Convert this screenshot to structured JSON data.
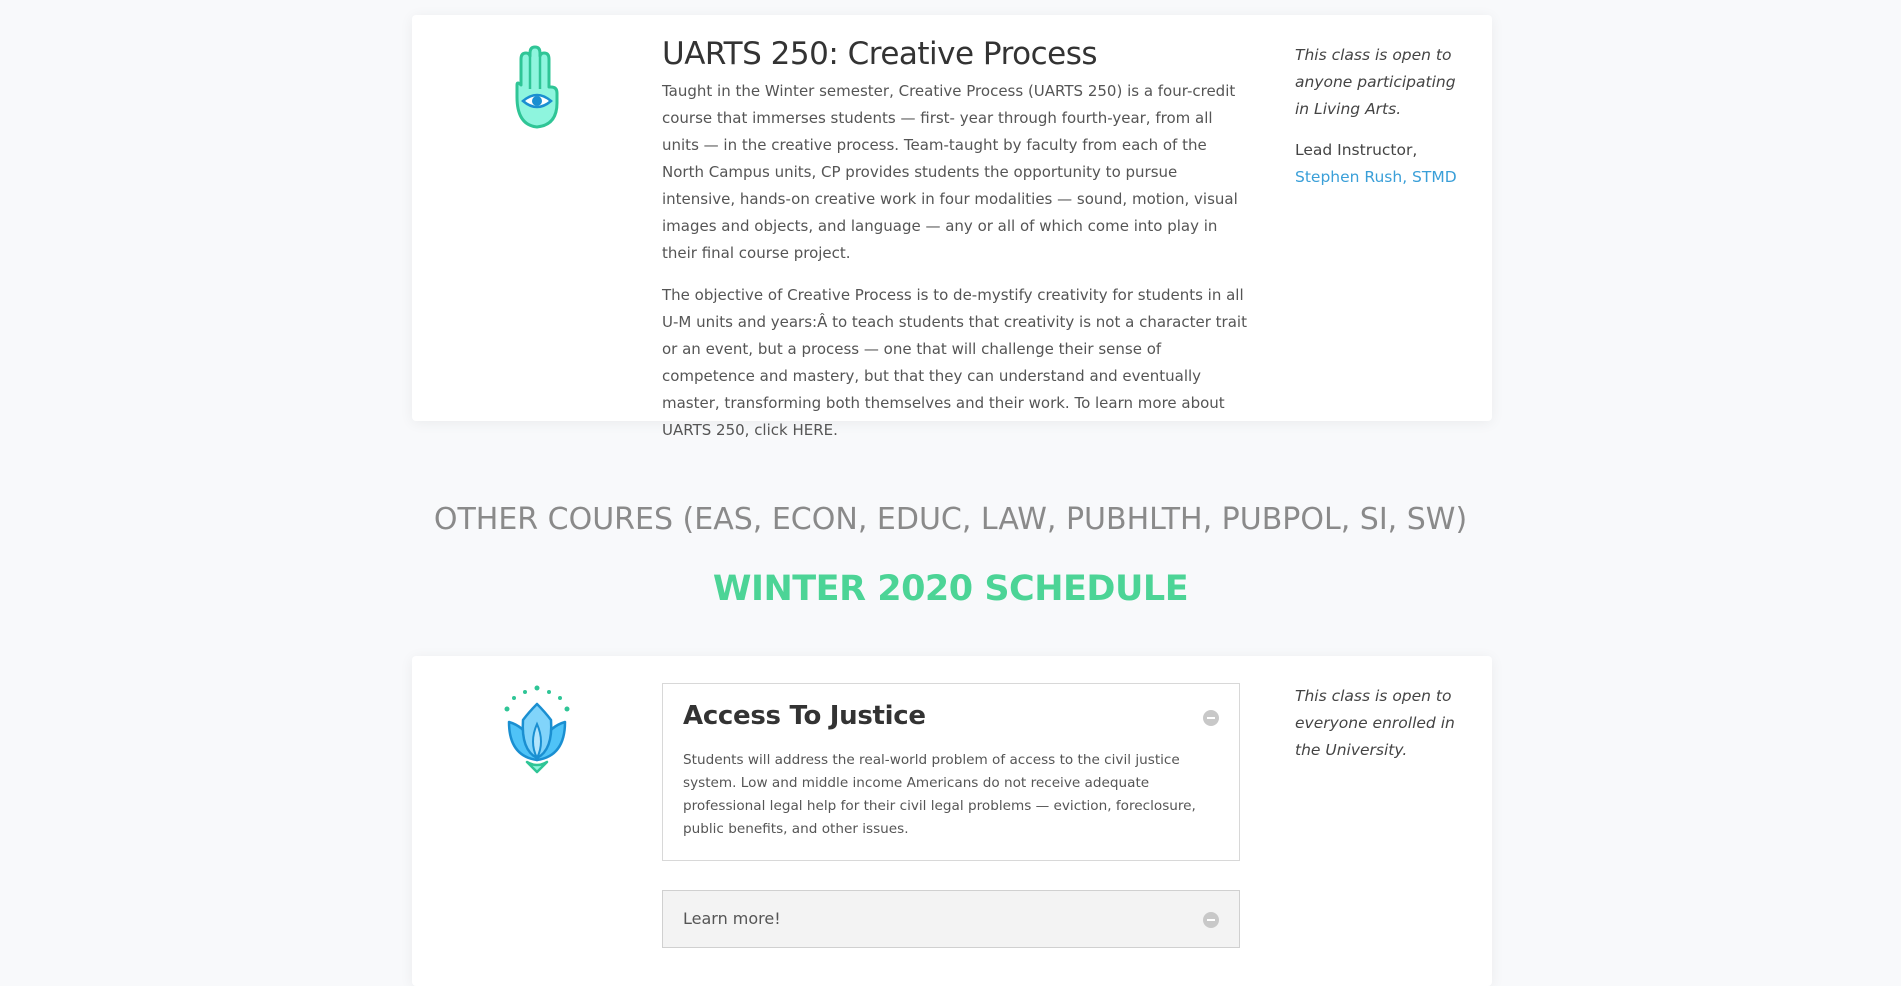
{
  "course1": {
    "title": "UARTS 250: Creative Process",
    "para1": "Taught in the Winter semester, Creative Process (UARTS 250) is a four-credit course that immerses students — first- year through fourth-year, from all units — in the creative process.  Team-taught by faculty from each of the North Campus units, CP provides students the opportunity to pursue intensive, hands-on creative work in four modalities — sound, motion, visual images and objects, and language — any or all of which come into play in their final course project.",
    "para2": "The objective of Creative Process is to de-mystify creativity for students in all U-M units and years:Â to teach students that creativity is not a character trait or an event, but a process — one that will challenge their sense of competence and mastery, but that they can understand and eventually master, transforming both themselves and their work.  To learn more about UARTS 250, click HERE.",
    "open_note": "This class is open to anyone participating in Living Arts.",
    "lead_label": "Lead Instructor,",
    "lead_name": "Stephen Rush, STMD",
    "icon": "hand-eye-icon"
  },
  "section_heading": "OTHER COURES (EAS, ECON, EDUC, LAW, PUBHLTH, PUBPOL, SI, SW)",
  "schedule_heading": "WINTER 2020 SCHEDULE",
  "course2": {
    "title": "Access To Justice",
    "body": "Students will address the real-world problem of access to the civil justice system. Low and middle income Americans do not receive adequate professional legal help for their civil legal problems — eviction, foreclosure, public benefits, and other issues.",
    "learn_more": "Learn more!",
    "open_note": "This class is open to everyone enrolled in the University.",
    "icon": "lotus-icon"
  },
  "colors": {
    "accent_green": "#4cd496",
    "link_blue": "#3a9fd8",
    "icon_teal": "#5fe0c4",
    "icon_blue": "#4fc3f7"
  }
}
